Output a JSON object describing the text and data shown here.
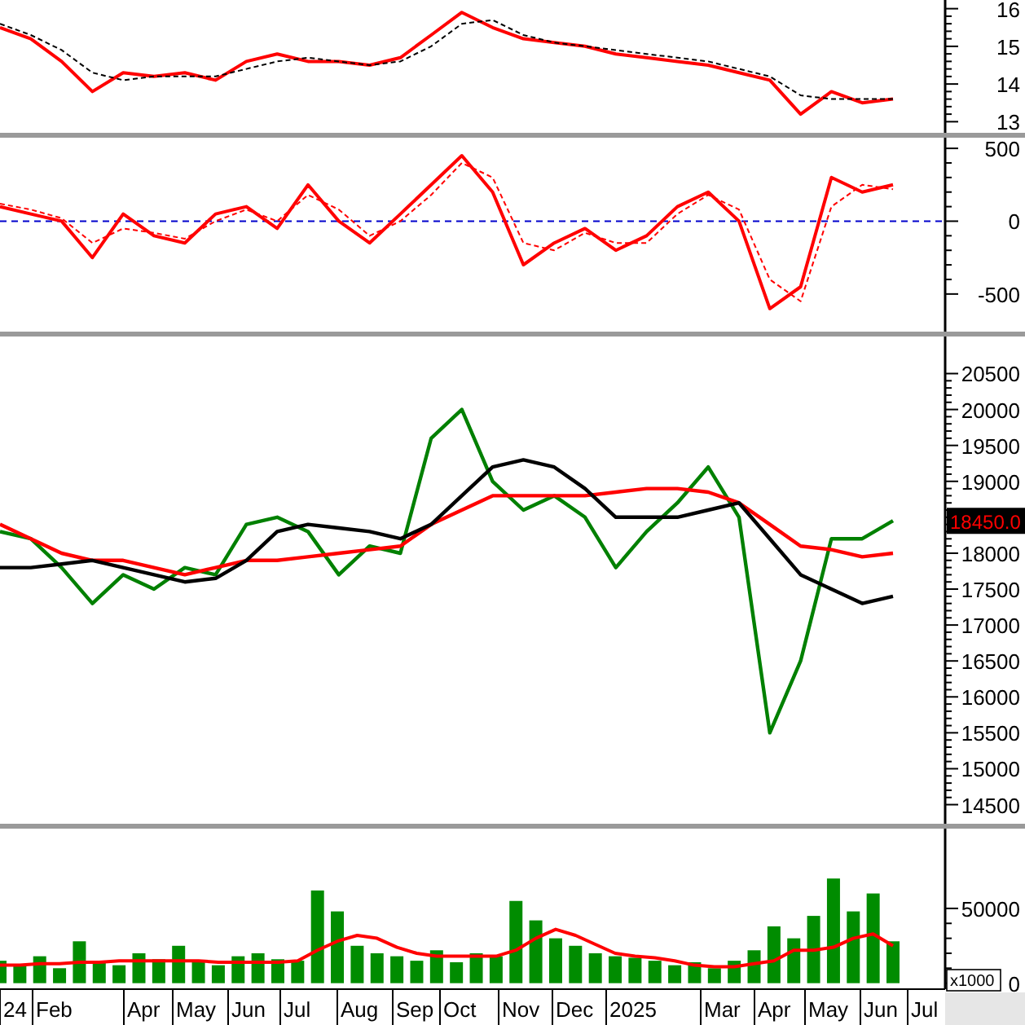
{
  "panels": [
    {
      "kind": "indicator",
      "chart_data": {
        "type": "line",
        "ylim": [
          12.64,
          16.23
        ],
        "yticks": [
          13,
          14,
          15,
          16
        ],
        "series": [
          {
            "color": "#ff0000",
            "line_style": "solid",
            "values": [
              15.5,
              15.2,
              14.6,
              13.8,
              14.3,
              14.2,
              14.3,
              14.1,
              14.6,
              14.8,
              14.6,
              14.6,
              14.5,
              14.7,
              15.3,
              15.9,
              15.5,
              15.2,
              15.1,
              15.0,
              14.8,
              14.7,
              14.6,
              14.5,
              14.3,
              14.1,
              13.2,
              13.8,
              13.5,
              13.6
            ]
          },
          {
            "color": "#000000",
            "line_style": "dashed",
            "values": [
              15.6,
              15.3,
              14.9,
              14.3,
              14.1,
              14.2,
              14.2,
              14.2,
              14.4,
              14.6,
              14.7,
              14.6,
              14.5,
              14.6,
              15.0,
              15.6,
              15.7,
              15.3,
              15.1,
              15.0,
              14.9,
              14.8,
              14.7,
              14.6,
              14.4,
              14.2,
              13.7,
              13.6,
              13.6,
              13.6
            ]
          }
        ]
      }
    },
    {
      "kind": "indicator",
      "chart_data": {
        "type": "line",
        "ylim": [
          -775,
          590
        ],
        "yticks": [
          -500,
          0,
          500
        ],
        "ref_lines": [
          {
            "axis": "y",
            "value": 0,
            "color": "#0000cc",
            "line_style": "dashed"
          }
        ],
        "series": [
          {
            "color": "#ff0000",
            "line_style": "solid",
            "values": [
              100,
              50,
              0,
              -250,
              50,
              -100,
              -150,
              50,
              100,
              -50,
              250,
              0,
              -150,
              50,
              250,
              450,
              200,
              -300,
              -150,
              -50,
              -200,
              -100,
              100,
              200,
              0,
              -600,
              -450,
              300,
              200,
              250
            ]
          },
          {
            "color": "#ff0000",
            "line_style": "dashed",
            "values": [
              120,
              80,
              20,
              -150,
              -50,
              -80,
              -120,
              0,
              80,
              0,
              180,
              80,
              -100,
              0,
              180,
              400,
              300,
              -150,
              -200,
              -80,
              -150,
              -150,
              50,
              180,
              80,
              -400,
              -550,
              100,
              250,
              220
            ]
          }
        ]
      }
    },
    {
      "kind": "price",
      "price_badge": "18450.0",
      "chart_data": {
        "type": "line",
        "ylim": [
          14200,
          21050
        ],
        "yticks": [
          14500,
          15000,
          15500,
          16000,
          16500,
          17000,
          17500,
          18000,
          19000,
          19500,
          20000,
          20500
        ],
        "series": [
          {
            "color": "#008000",
            "line_style": "solid",
            "values": [
              18300,
              18200,
              17800,
              17300,
              17700,
              17500,
              17800,
              17700,
              18400,
              18500,
              18300,
              17700,
              18100,
              18000,
              19600,
              20000,
              19000,
              18600,
              18800,
              18500,
              17800,
              18300,
              18700,
              19200,
              18500,
              15500,
              16500,
              18200,
              18200,
              18450
            ]
          },
          {
            "color": "#ff0000",
            "line_style": "solid",
            "values": [
              18400,
              18200,
              18000,
              17900,
              17900,
              17800,
              17700,
              17800,
              17900,
              17900,
              17950,
              18000,
              18050,
              18100,
              18400,
              18600,
              18800,
              18800,
              18800,
              18800,
              18850,
              18900,
              18900,
              18850,
              18700,
              18400,
              18100,
              18050,
              17950,
              18000
            ]
          },
          {
            "color": "#000000",
            "line_style": "solid",
            "values": [
              17800,
              17800,
              17850,
              17900,
              17800,
              17700,
              17600,
              17650,
              17900,
              18300,
              18400,
              18350,
              18300,
              18200,
              18400,
              18800,
              19200,
              19300,
              19200,
              18900,
              18500,
              18500,
              18500,
              18600,
              18700,
              18200,
              17700,
              17500,
              17300,
              17400
            ]
          }
        ]
      }
    },
    {
      "kind": "volume",
      "unit_label": "x1000",
      "chart_data": {
        "type": "bar",
        "categories": [
          null,
          null,
          null,
          null,
          null,
          null,
          null,
          null,
          null,
          null,
          null,
          null,
          null,
          null,
          null,
          null,
          null,
          null,
          null,
          null,
          null,
          null,
          null,
          null,
          null,
          null,
          null,
          null,
          null,
          null,
          null,
          null,
          null,
          null,
          null,
          null,
          null,
          null,
          null,
          null,
          null,
          null,
          null,
          null,
          null,
          null
        ],
        "ylim": [
          -4000,
          105000
        ],
        "yticks": [
          0,
          50000
        ],
        "series": [
          {
            "type": "bar",
            "color": "#008c00",
            "values": [
              15000,
              12000,
              18000,
              10000,
              28000,
              14000,
              12000,
              20000,
              16000,
              25000,
              14000,
              12000,
              18000,
              20000,
              16000,
              15000,
              62000,
              48000,
              25000,
              20000,
              18000,
              15000,
              22000,
              14000,
              20000,
              18000,
              55000,
              42000,
              30000,
              25000,
              20000,
              18000,
              17000,
              15000,
              12000,
              14000,
              10000,
              15000,
              22000,
              38000,
              30000,
              45000,
              70000,
              48000,
              60000,
              28000
            ]
          },
          {
            "type": "line",
            "color": "#ff0000",
            "values": [
              12000,
              12000,
              13000,
              13000,
              14000,
              14000,
              15000,
              15000,
              15000,
              15000,
              15000,
              14000,
              14000,
              14000,
              14000,
              15000,
              22000,
              28000,
              32000,
              30000,
              24000,
              20000,
              18000,
              18000,
              18000,
              18000,
              22000,
              30000,
              36000,
              32000,
              26000,
              20000,
              18000,
              17000,
              15000,
              12000,
              11000,
              11000,
              13000,
              15000,
              22000,
              22000,
              24000,
              30000,
              33000,
              25000
            ]
          }
        ]
      }
    }
  ],
  "time_axis": {
    "labels": [
      "24",
      "Feb",
      "Apr",
      "May",
      "Jun",
      "Jul",
      "Aug",
      "Sep",
      "Oct",
      "Nov",
      "Dec",
      "2025",
      "Mar",
      "Apr",
      "May",
      "Jun",
      "Jul"
    ]
  }
}
